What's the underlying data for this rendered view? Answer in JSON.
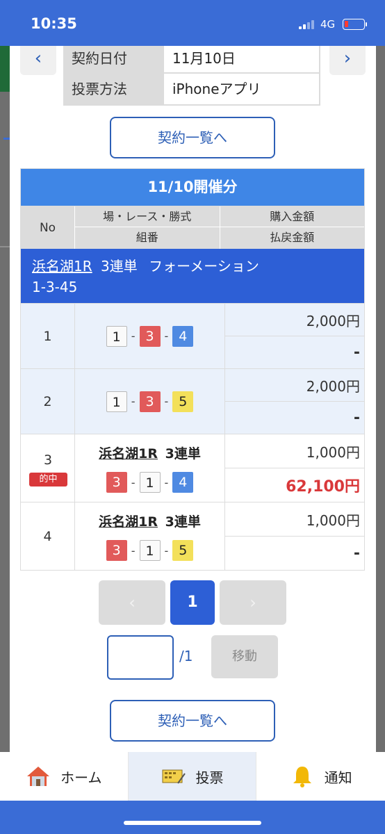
{
  "status": {
    "time": "10:35",
    "network": "4G"
  },
  "contract": {
    "date_label": "契約日付",
    "date_value": "11月10日",
    "method_label": "投票方法",
    "method_value": "iPhoneアプリ",
    "prev_icon": "chevron-left-icon",
    "next_icon": "chevron-right-icon"
  },
  "list_button_label": "契約一覧へ",
  "results": {
    "title": "11/10開催分",
    "header": {
      "no": "No",
      "race": "場・レース・勝式",
      "amount": "購入金額",
      "combo": "組番",
      "payout": "払戻金額"
    },
    "bet": {
      "venue_race": "浜名湖1R",
      "type": "3連単",
      "style": "フォーメーション",
      "combo": "1-3-45"
    },
    "rows": [
      {
        "no": "1",
        "combo": [
          "1",
          "3",
          "4"
        ],
        "amount": "2,000円",
        "payout": "-"
      },
      {
        "no": "2",
        "combo": [
          "1",
          "3",
          "5"
        ],
        "amount": "2,000円",
        "payout": "-"
      },
      {
        "no": "3",
        "badge": "的中",
        "venue_race": "浜名湖1R",
        "type": "3連単",
        "combo": [
          "3",
          "1",
          "4"
        ],
        "amount": "1,000円",
        "payout": "62,100円"
      },
      {
        "no": "4",
        "venue_race": "浜名湖1R",
        "type": "3連単",
        "combo": [
          "3",
          "1",
          "5"
        ],
        "amount": "1,000円",
        "payout": "-"
      }
    ],
    "separator": "-"
  },
  "pagination": {
    "prev": "‹",
    "current": "1",
    "next": "›",
    "total": "/1",
    "move_label": "移動",
    "input_value": ""
  },
  "tabbar": {
    "home": "ホーム",
    "vote": "投票",
    "notify": "通知",
    "icons": [
      "house-icon",
      "ticket-icon",
      "bell-icon"
    ]
  },
  "colors": {
    "accent": "#2d5fd6",
    "header_blue": "#3f86e6",
    "win_red": "#d9383a"
  }
}
